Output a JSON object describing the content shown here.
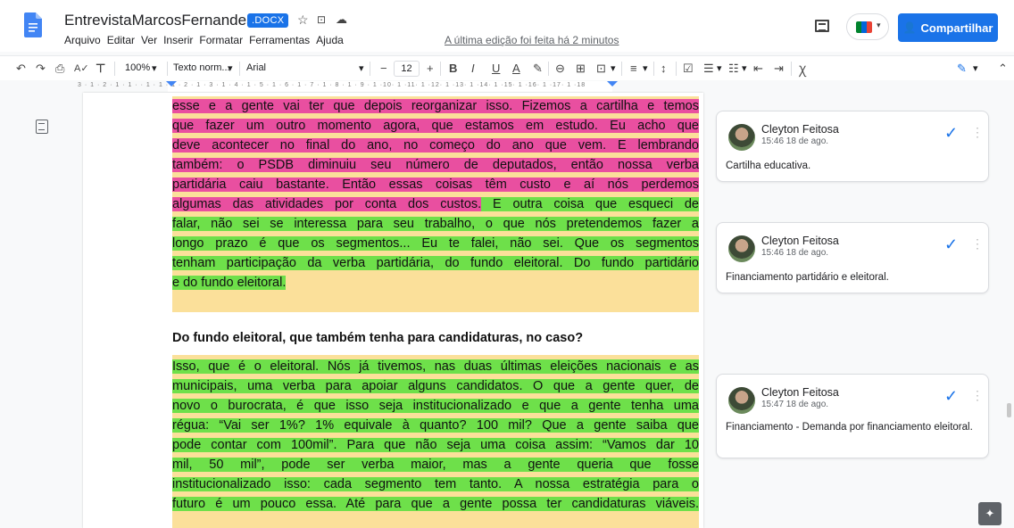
{
  "header": {
    "doc_title": "EntrevistaMarcosFernandes",
    "file_badge": ".DOCX",
    "star_icon": "star-icon",
    "move_icon": "folder-move-icon",
    "cloud_icon": "cloud-status-icon",
    "menus": [
      "Arquivo",
      "Editar",
      "Ver",
      "Inserir",
      "Formatar",
      "Ferramentas",
      "Ajuda"
    ],
    "last_edit": "A última edição foi feita há 2 minutos",
    "share_label": "Compartilhar"
  },
  "toolbar": {
    "zoom": "100%",
    "style": "Texto norm...",
    "font": "Arial",
    "font_size": "12",
    "minus": "−",
    "plus": "+",
    "bold": "B",
    "italic": "I",
    "underline": "U",
    "text_color": "A"
  },
  "ruler": {
    "text": "3 · 1 · 2 · 1 · 1 ·   · 1 · 1 · 1 · 2 · 1 · 3 · 1 · 4 · 1 · 5 · 1 · 6 · 1 · 7 · 1 · 8 · 1 · 9 · 1 ·10· 1 ·11· 1 ·12· 1 ·13· 1 ·14· 1 ·15· 1 ·16· 1 ·17· 1 ·18"
  },
  "document": {
    "lines": [
      {
        "hl": "pink",
        "text": "esse e a gente vai ter que depois reorganizar isso.",
        "tail": " Fizemos a cartilha e temos",
        "tail_hl": "pink"
      },
      {
        "hl": "pink",
        "text": "que fazer um outro momento agora, que estamos em estudo. Eu acho que"
      },
      {
        "hl": "pink",
        "text": "deve acontecer no final do ano, no começo do ano que vem. E lembrando"
      },
      {
        "hl": "pink",
        "text": "também: o PSDB diminuiu seu número de deputados, então nossa verba"
      },
      {
        "hl": "pink",
        "text": "partidária caiu bastante. Então essas coisas têm custo e aí nós perdemos"
      },
      {
        "hl": "pink",
        "text": "algumas das atividades por conta dos custos.",
        "tail": " E outra coisa que esqueci de",
        "tail_hl": "green"
      },
      {
        "hl": "green",
        "text": "falar, não sei se interessa para seu trabalho, o que nós pretendemos fazer a"
      },
      {
        "hl": "green",
        "text": "longo prazo é que os segmentos... Eu te falei, não sei. Que os segmentos"
      },
      {
        "hl": "green",
        "text": "tenham participação da verba partidária, do fundo eleitoral. Do fundo partidário"
      },
      {
        "hl": "green",
        "text": "e do fundo eleitoral."
      }
    ],
    "question": "Do fundo eleitoral, que também tenha para candidaturas, no caso?",
    "answer_lines": [
      "Isso, que é o eleitoral. Nós já tivemos, nas duas últimas eleições nacionais e as",
      "municipais, uma verba para apoiar alguns candidatos. O que a gente quer, de",
      "novo o burocrata, é que isso seja institucionalizado e que a gente tenha uma",
      "régua: “Vai ser 1%? 1% equivale à quanto? 100 mil? Que a gente saiba que",
      "pode contar com 100mil”. Para que não seja uma coisa assim: “Vamos dar 10",
      "mil, 50 mil”, pode ser verba maior, mas a gente queria que fosse",
      "institucionalizado isso: cada segmento tem tanto. A nossa estratégia para o",
      "futuro é um pouco essa. Até para que a gente possa ter candidaturas viáveis."
    ]
  },
  "comments": [
    {
      "author": "Cleyton Feitosa",
      "time": "15:46 18 de ago.",
      "text": "Cartilha educativa."
    },
    {
      "author": "Cleyton Feitosa",
      "time": "15:46 18 de ago.",
      "text": "Financiamento partidário e eleitoral."
    },
    {
      "author": "Cleyton Feitosa",
      "time": "15:47 18 de ago.",
      "text": "Financiamento - Demanda por financiamento eleitoral."
    }
  ],
  "colors": {
    "accent": "#1a73e8",
    "highlight_pink": "#e94fa0",
    "highlight_green": "#6ee04a",
    "highlight_yellow": "#fbe09a"
  }
}
